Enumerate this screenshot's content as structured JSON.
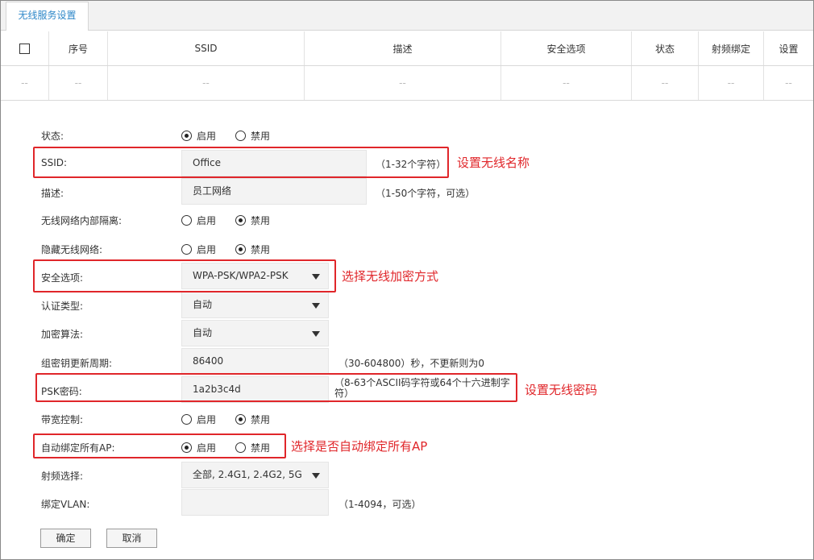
{
  "tab": {
    "label": "无线服务设置"
  },
  "table": {
    "headers": [
      "序号",
      "SSID",
      "描述",
      "安全选项",
      "状态",
      "射频绑定",
      "设置"
    ],
    "row_placeholder": "--"
  },
  "form": {
    "status": {
      "label": "状态:",
      "opt_on": "启用",
      "opt_off": "禁用",
      "selected": "启用"
    },
    "ssid": {
      "label": "SSID:",
      "value": "Office",
      "hint": "（1-32个字符）"
    },
    "desc": {
      "label": "描述:",
      "value": "员工网络",
      "hint": "（1-50个字符，可选）"
    },
    "isolation": {
      "label": "无线网络内部隔离:",
      "opt_on": "启用",
      "opt_off": "禁用",
      "selected": "禁用"
    },
    "hide": {
      "label": "隐藏无线网络:",
      "opt_on": "启用",
      "opt_off": "禁用",
      "selected": "禁用"
    },
    "security": {
      "label": "安全选项:",
      "value": "WPA-PSK/WPA2-PSK"
    },
    "auth": {
      "label": "认证类型:",
      "value": "自动"
    },
    "cipher": {
      "label": "加密算法:",
      "value": "自动"
    },
    "rekey": {
      "label": "组密钥更新周期:",
      "value": "86400",
      "hint": "（30-604800）秒，不更新则为0"
    },
    "psk": {
      "label": "PSK密码:",
      "value": "1a2b3c4d",
      "hint": "（8-63个ASCII码字符或64个十六进制字符）"
    },
    "bandwidth": {
      "label": "带宽控制:",
      "opt_on": "启用",
      "opt_off": "禁用",
      "selected": "禁用"
    },
    "autobind": {
      "label": "自动绑定所有AP:",
      "opt_on": "启用",
      "opt_off": "禁用",
      "selected": "启用"
    },
    "radio": {
      "label": "射频选择:",
      "value": "全部, 2.4G1, 2.4G2, 5G"
    },
    "vlan": {
      "label": "绑定VLAN:",
      "value": "",
      "hint": "（1-4094，可选）"
    }
  },
  "buttons": {
    "ok": "确定",
    "cancel": "取消"
  },
  "annotations": {
    "ssid": "设置无线名称",
    "security": "选择无线加密方式",
    "psk": "设置无线密码",
    "autobind": "选择是否自动绑定所有AP"
  },
  "colors": {
    "accent": "#2d87c8",
    "annotation": "#e0262a"
  }
}
